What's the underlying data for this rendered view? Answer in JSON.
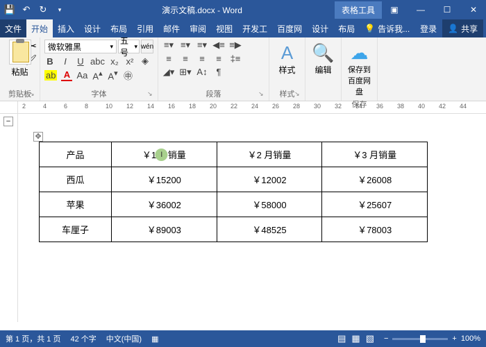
{
  "titlebar": {
    "title": "演示文稿.docx - Word",
    "tableTools": "表格工具"
  },
  "tabs": {
    "file": "文件",
    "home": "开始",
    "insert": "插入",
    "design": "设计",
    "layout": "布局",
    "references": "引用",
    "mailings": "邮件",
    "review": "审阅",
    "view": "视图",
    "developer": "开发工",
    "baidu": "百度网",
    "tdesign": "设计",
    "tlayout": "布局",
    "tell": "告诉我...",
    "login": "登录",
    "share": "共享"
  },
  "ribbon": {
    "clipboard": {
      "paste": "粘贴",
      "label": "剪贴板"
    },
    "font": {
      "name": "微软雅黑",
      "size": "五号",
      "label": "字体"
    },
    "paragraph": {
      "label": "段落"
    },
    "styles": {
      "btn": "样式",
      "label": "样式"
    },
    "editing": {
      "btn": "编辑"
    },
    "save": {
      "btn": "保存到百度网盘",
      "label": "保存"
    }
  },
  "ruler": {
    "marks": [
      "2",
      "4",
      "6",
      "8",
      "10",
      "12",
      "14",
      "16",
      "18",
      "20",
      "22",
      "24",
      "26",
      "28",
      "30",
      "32",
      "34",
      "36",
      "38",
      "40",
      "42",
      "44"
    ]
  },
  "table": {
    "headers": [
      "产品",
      "￥1 月销量",
      "￥2 月销量",
      "￥3 月销量"
    ],
    "rows": [
      [
        "西瓜",
        "￥15200",
        "￥12002",
        "￥26008"
      ],
      [
        "苹果",
        "￥36002",
        "￥58000",
        "￥25607"
      ],
      [
        "车厘子",
        "￥89003",
        "￥48525",
        "￥78003"
      ]
    ]
  },
  "status": {
    "page": "第 1 页，共 1 页",
    "words": "42 个字",
    "lang": "中文(中国)",
    "zoom": "100%"
  }
}
